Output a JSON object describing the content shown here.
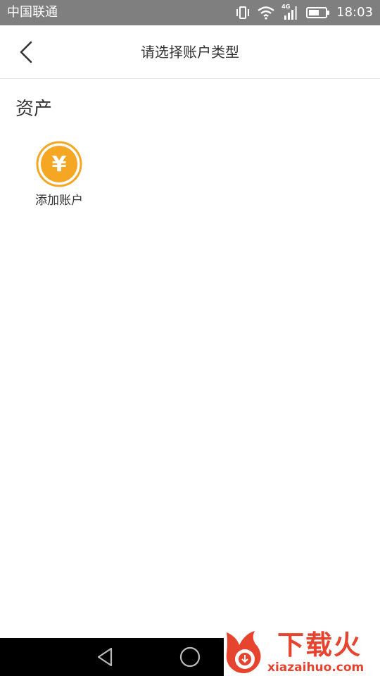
{
  "status_bar": {
    "carrier": "中国联通",
    "network": "4G",
    "time": "18:03"
  },
  "header": {
    "title": "请选择账户类型"
  },
  "section": {
    "title": "资产",
    "add_account_label": "添加账户",
    "coin_symbol": "¥"
  },
  "watermark": {
    "main": "下载火",
    "sub": "xiazaihuo.com"
  },
  "colors": {
    "status_bar_bg": "#7f7f7f",
    "coin_accent": "#f5a623",
    "watermark": "#e6442e"
  },
  "icons": {
    "back": "chevron-left-icon",
    "coin": "yuan-coin-icon",
    "nav_back": "triangle-back-icon",
    "nav_home": "circle-home-icon"
  }
}
